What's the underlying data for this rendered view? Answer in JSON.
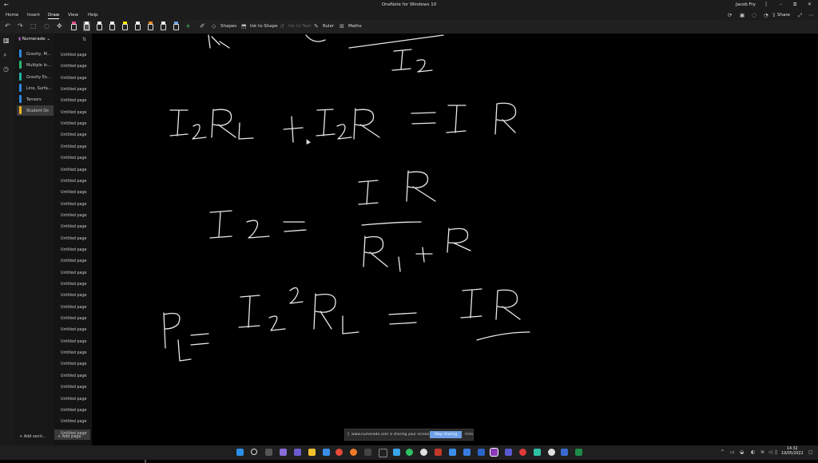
{
  "window": {
    "title": "OneNote for Windows 10",
    "user": "Jacob Fry"
  },
  "menu": {
    "tabs": [
      "Home",
      "Insert",
      "Draw",
      "View",
      "Help"
    ],
    "active": "Draw",
    "share_label": "Share"
  },
  "toolbar": {
    "shapes_label": "Shapes",
    "ink_to_shape_label": "Ink to Shape",
    "ink_to_text_label": "Ink to Text",
    "ruler_label": "Ruler",
    "maths_label": "Maths",
    "pen_colors": [
      "#e84b8a",
      "#ffffff",
      "#ffffff",
      "#f5e600",
      "#ffffff",
      "#ffffff",
      "#f08a24",
      "#ffffff",
      "#6ea0e8",
      "#ffffff"
    ]
  },
  "notebook": {
    "name": "Numerade",
    "sections": [
      {
        "label": "Gravity, M...",
        "color": "#2f88e0"
      },
      {
        "label": "Multiple In...",
        "color": "#2bb673"
      },
      {
        "label": "Gravity Ex...",
        "color": "#1fb5a4"
      },
      {
        "label": "Line, Surfa...",
        "color": "#2f88e0"
      },
      {
        "label": "Tensors",
        "color": "#2f88e0"
      },
      {
        "label": "Student Qs",
        "color": "#f2b01e"
      }
    ],
    "add_section_label": "Add secti..."
  },
  "pages": {
    "items": [
      "Untitled page",
      "Untitled page",
      "Untitled page",
      "Untitled page",
      "Untitled page",
      "Untitled page",
      "Untitled page",
      "Untitled page",
      "Untitled page",
      "Untitled page",
      "Untitled page",
      "Untitled page",
      "Untitled page",
      "Untitled page",
      "Untitled page",
      "Untitled page",
      "Untitled page",
      "Untitled page",
      "Untitled page",
      "Untitled page",
      "Untitled page",
      "Untitled page",
      "Untitled page",
      "Untitled page",
      "Untitled page",
      "Untitled page",
      "Untitled page",
      "Untitled page",
      "Untitled page",
      "Untitled page",
      "Untitled page",
      "Untitled page",
      "Untitled page",
      "Untitled page"
    ],
    "add_page_label": "Add page"
  },
  "sharing_banner": {
    "message": "www.numerade.com is sharing your screen.",
    "stop_label": "Stop sharing",
    "hide_label": "Hide"
  },
  "taskbar": {
    "time": "14:32",
    "date": "19/05/2022"
  },
  "ink_notes": {
    "line1": "I2",
    "line2": "I2RL + I2R = IR",
    "line3": "I2 = IR / (RL + R)",
    "line4": "PL = I2²RL = IR"
  }
}
